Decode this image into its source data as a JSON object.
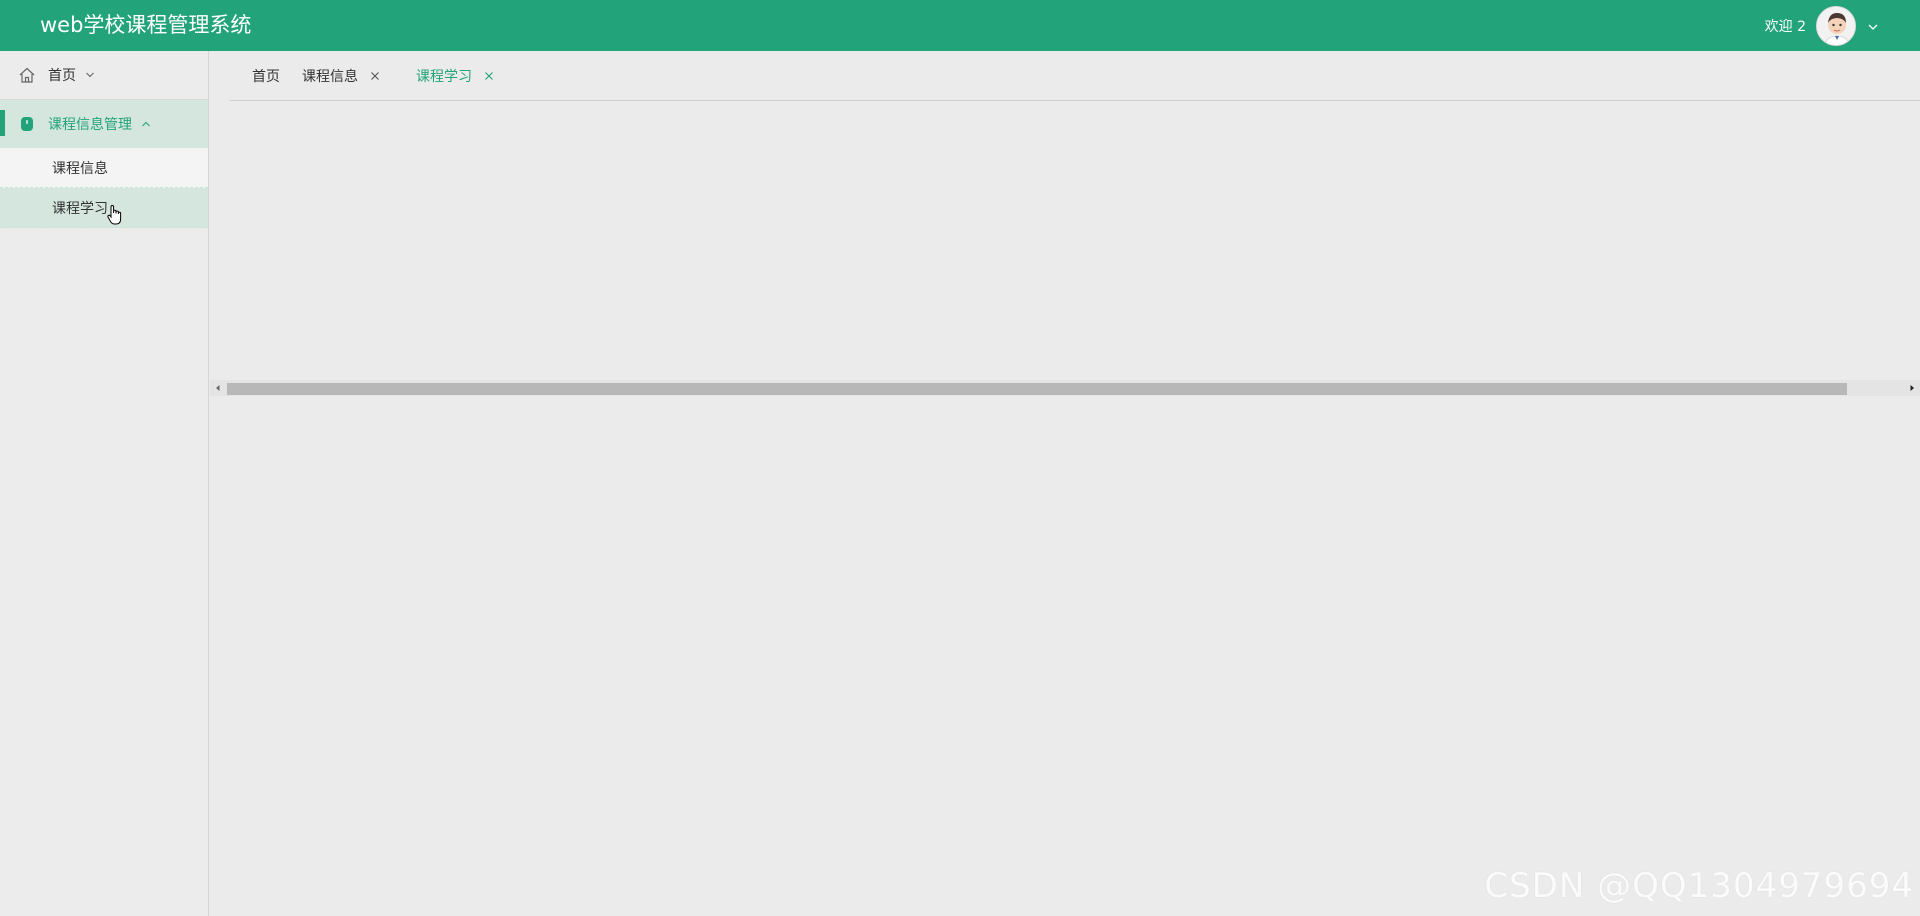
{
  "header": {
    "title": "web学校课程管理系统",
    "welcome": "欢迎 2",
    "avatar": "avatar-image",
    "user_menu_icon": "chevron-down-icon"
  },
  "sidebar": {
    "home": {
      "label": "首页",
      "icon": "home-icon",
      "chevron": "chevron-down-icon"
    },
    "group": {
      "label": "课程信息管理",
      "icon": "course-icon",
      "chevron": "chevron-up-icon",
      "items": [
        {
          "label": "课程信息"
        },
        {
          "label": "课程学习"
        }
      ]
    }
  },
  "tabs": [
    {
      "label": "首页",
      "closable": false,
      "active": false
    },
    {
      "label": "课程信息",
      "closable": true,
      "active": false
    },
    {
      "label": "课程学习",
      "closable": true,
      "active": true
    }
  ],
  "scrollbar": {
    "orientation": "horizontal"
  },
  "watermark": "CSDN @QQ1304979694",
  "colors": {
    "brand": "#22a379",
    "sidebar_bg": "#ececec",
    "selected_bg": "#d5e6df",
    "content_bg": "#ebebeb"
  }
}
